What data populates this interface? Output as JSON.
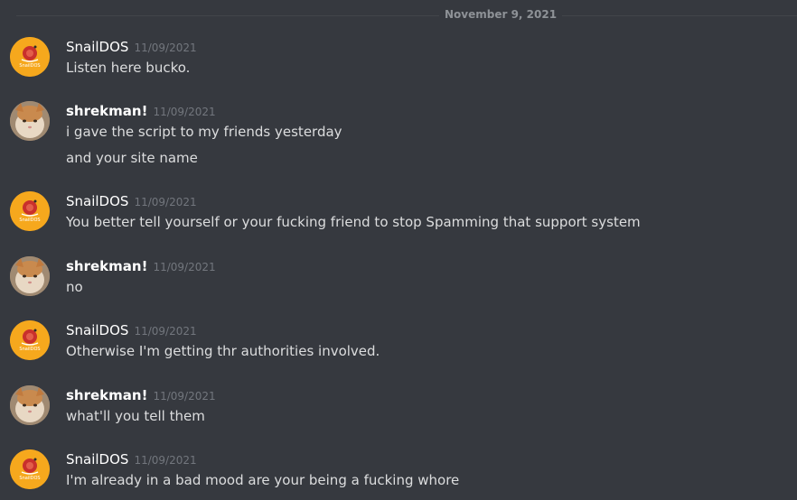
{
  "date_divider": "November 9, 2021",
  "users": {
    "snail": "SnailDOS",
    "shrek": "shrekman!"
  },
  "avatar_icons": {
    "snail": "snail-logo-icon",
    "shrek": "cat-photo-icon"
  },
  "avatar_logo_text": "SnailDOS",
  "groups": [
    {
      "author": "SnailDOS",
      "timestamp": "11/09/2021",
      "lines": [
        "Listen here bucko."
      ]
    },
    {
      "author": "shrekman!",
      "timestamp": "11/09/2021",
      "lines": [
        "i gave the script to my friends yesterday",
        "and your site name"
      ]
    },
    {
      "author": "SnailDOS",
      "timestamp": "11/09/2021",
      "lines": [
        "You better tell yourself or your fucking friend to stop Spamming that support system"
      ]
    },
    {
      "author": "shrekman!",
      "timestamp": "11/09/2021",
      "lines": [
        "no"
      ]
    },
    {
      "author": "SnailDOS",
      "timestamp": "11/09/2021",
      "lines": [
        "Otherwise I'm getting thr authorities involved."
      ]
    },
    {
      "author": "shrekman!",
      "timestamp": "11/09/2021",
      "lines": [
        "what'll you tell them"
      ]
    },
    {
      "author": "SnailDOS",
      "timestamp": "11/09/2021",
      "lines": [
        "I'm already in a bad mood are your being a fucking whore"
      ]
    }
  ],
  "colors": {
    "background": "#36393f",
    "username": "#ffffff",
    "message_text": "#dcddde",
    "timestamp": "#72767d",
    "snail_avatar_bg": "#f6a81d"
  }
}
